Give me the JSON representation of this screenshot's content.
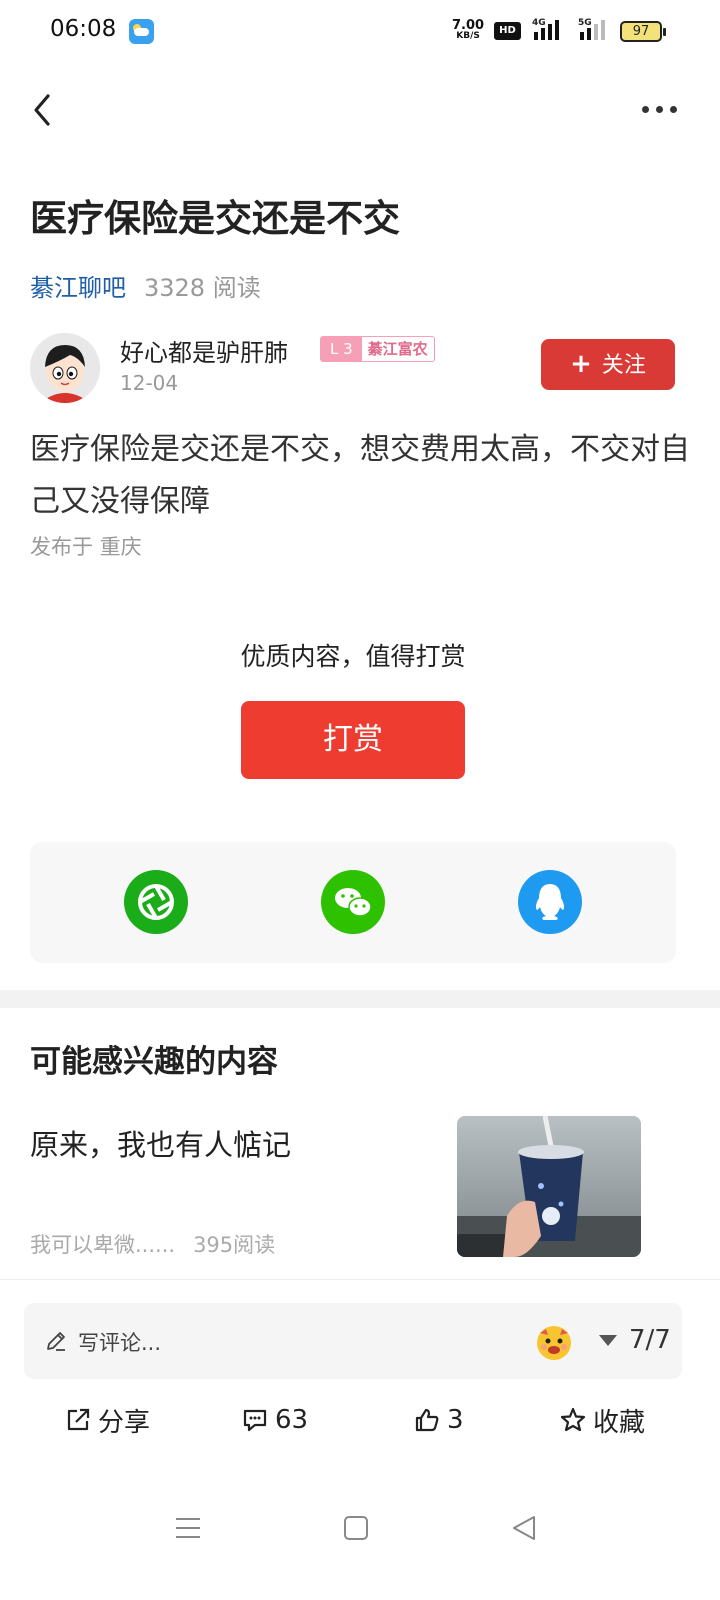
{
  "status": {
    "time": "06:08",
    "speed_value": "7.00",
    "speed_unit": "KB/S",
    "hd": "HD",
    "network_4g": "4G",
    "network_5g": "5G",
    "battery": "97"
  },
  "post": {
    "title": "医疗保险是交还是不交",
    "forum": "綦江聊吧",
    "reads": "3328 阅读",
    "author": "好心都是驴肝肺",
    "level": "L 3",
    "tag": "綦江富农",
    "date": "12-04",
    "follow_label": "关注",
    "content": "医疗保险是交还是不交，想交费用太高，不交对自己又没得保障",
    "location": "发布于 重庆"
  },
  "reward": {
    "hint": "优质内容，值得打赏",
    "button": "打赏"
  },
  "share": {
    "colors": {
      "moments": "#1aad19",
      "wechat": "#2dc100",
      "qq": "#1e9bf0"
    }
  },
  "recommend": {
    "section_title": "可能感兴趣的内容",
    "items": [
      {
        "title": "原来，我也有人惦记",
        "author": "我可以卑微......",
        "reads": "395阅读"
      }
    ]
  },
  "comment": {
    "placeholder": "写评论...",
    "page": "7/7"
  },
  "actions": {
    "share": "分享",
    "comments": "63",
    "likes": "3",
    "favorite": "收藏"
  },
  "colors": {
    "accent": "#d93a35",
    "reward": "#ee3c31",
    "link": "#1f5fa8"
  }
}
